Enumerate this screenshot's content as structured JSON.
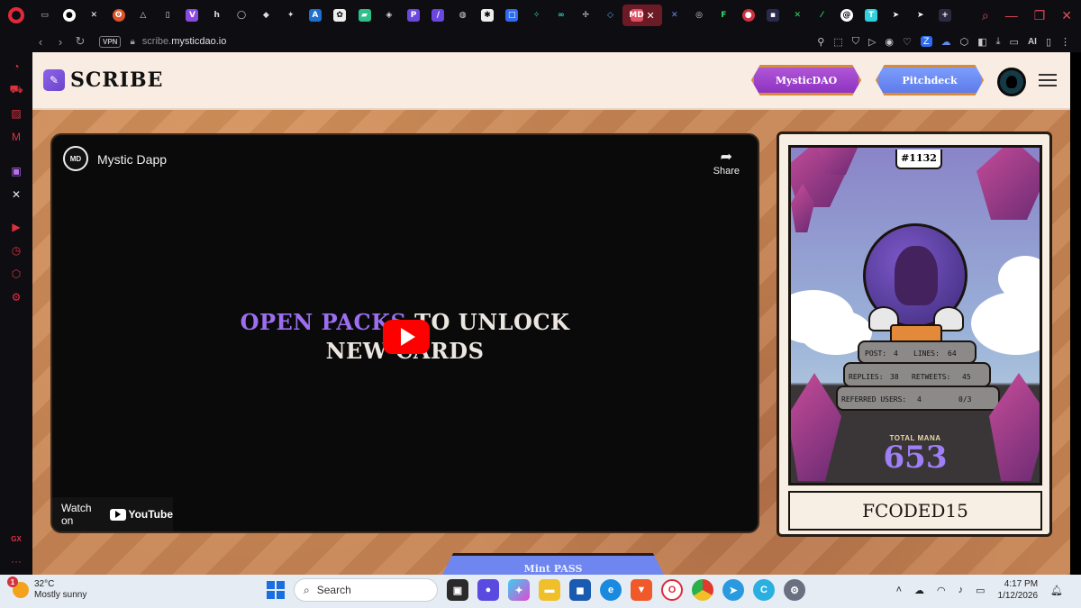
{
  "browser": {
    "url_host": "scribe.",
    "url_domain": "mysticdao.io",
    "vpn_label": "VPN",
    "ai_label": "AI",
    "active_tab_label": "MD"
  },
  "site": {
    "logo_text": "SCRIBE",
    "nav": {
      "mystic_label": "MysticDAO",
      "pitch_label": "Pitchdeck"
    }
  },
  "video": {
    "channel_initials": "MD",
    "title": "Mystic Dapp",
    "share_label": "Share",
    "headline_purple": "OPEN PACKS",
    "headline_rest": " TO UNLOCK",
    "headline_line2": "NEW CARDS",
    "watch_on": "Watch on",
    "youtube": "YouTube"
  },
  "card": {
    "number": "#1132",
    "stats": {
      "post_label": "POST:",
      "post_value": "4",
      "lines_label": "LINES:",
      "lines_value": "64",
      "replies_label": "REPLIES:",
      "replies_value": "38",
      "retweets_label": "RETWEETS:",
      "retweets_value": "45",
      "referred_label": "REFERRED USERS:",
      "referred_value": "4",
      "ratio_value": "0/3"
    },
    "mana_label": "TOTAL MANA",
    "mana_value": "653",
    "name": "FCODED15"
  },
  "bottom_button_label": "Mint PASS",
  "taskbar": {
    "weather_temp": "32°C",
    "weather_desc": "Mostly sunny",
    "weather_badge": "1",
    "search_placeholder": "Search",
    "time": "4:17 PM",
    "date": "1/12/2026"
  },
  "colors": {
    "header_bg": "#f9ece2",
    "accent_purple": "#9b6ff0",
    "mystic_button": "#a24bd0",
    "pitch_button": "#6f8cf5",
    "browser_accent": "#e02a3a"
  }
}
